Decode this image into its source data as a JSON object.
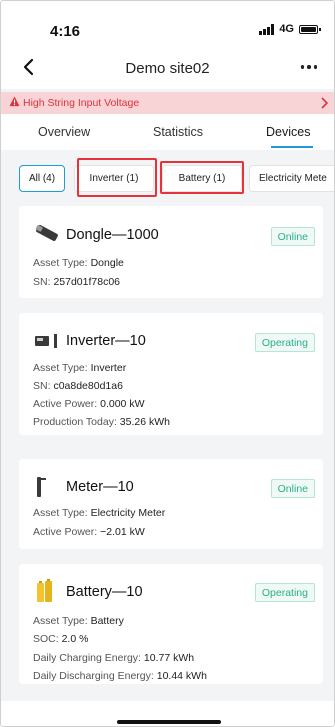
{
  "status_bar": {
    "time": "4:16",
    "network": "4G"
  },
  "header": {
    "title": "Demo site02"
  },
  "alert": {
    "text": "High String Input Voltage",
    "color": "#e0323d",
    "background": "#f9d4d6"
  },
  "tabs": [
    {
      "label": "Overview"
    },
    {
      "label": "Statistics"
    },
    {
      "label": "Devices",
      "active": true
    }
  ],
  "filters": [
    {
      "label": "All (4)",
      "selected": true
    },
    {
      "label": "Inverter (1)"
    },
    {
      "label": "Battery (1)"
    },
    {
      "label": "Electricity Mete"
    }
  ],
  "devices": [
    {
      "icon": "dongle-icon",
      "name": "Dongle—1000",
      "status": "Online",
      "fields": [
        {
          "label": "Asset Type:",
          "value": "Dongle"
        },
        {
          "label": "SN:",
          "value": "257d01f78c06"
        }
      ]
    },
    {
      "icon": "inverter-icon",
      "name": "Inverter—10",
      "status": "Operating",
      "fields": [
        {
          "label": "Asset Type:",
          "value": "Inverter"
        },
        {
          "label": "SN:",
          "value": "c0a8de80d1a6"
        },
        {
          "label": "Active Power:",
          "value": "0.000 kW"
        },
        {
          "label": "Production Today:",
          "value": "35.26 kWh"
        }
      ]
    },
    {
      "icon": "meter-icon",
      "name": "Meter—10",
      "status": "Online",
      "fields": [
        {
          "label": "Asset Type:",
          "value": "Electricity Meter"
        },
        {
          "label": "Active Power:",
          "value": "−2.01 kW"
        }
      ]
    },
    {
      "icon": "battery-icon",
      "name": "Battery—10",
      "status": "Operating",
      "fields": [
        {
          "label": "Asset Type:",
          "value": "Battery"
        },
        {
          "label": "SOC:",
          "value": "2.0 %"
        },
        {
          "label": "Daily Charging Energy:",
          "value": "10.77 kWh"
        },
        {
          "label": "Daily Discharging Energy:",
          "value": "10.44 kWh"
        }
      ]
    }
  ],
  "colors": {
    "accent": "#1f9bd6",
    "status_green": "#2bae8a",
    "highlight_red": "#e5333b"
  }
}
